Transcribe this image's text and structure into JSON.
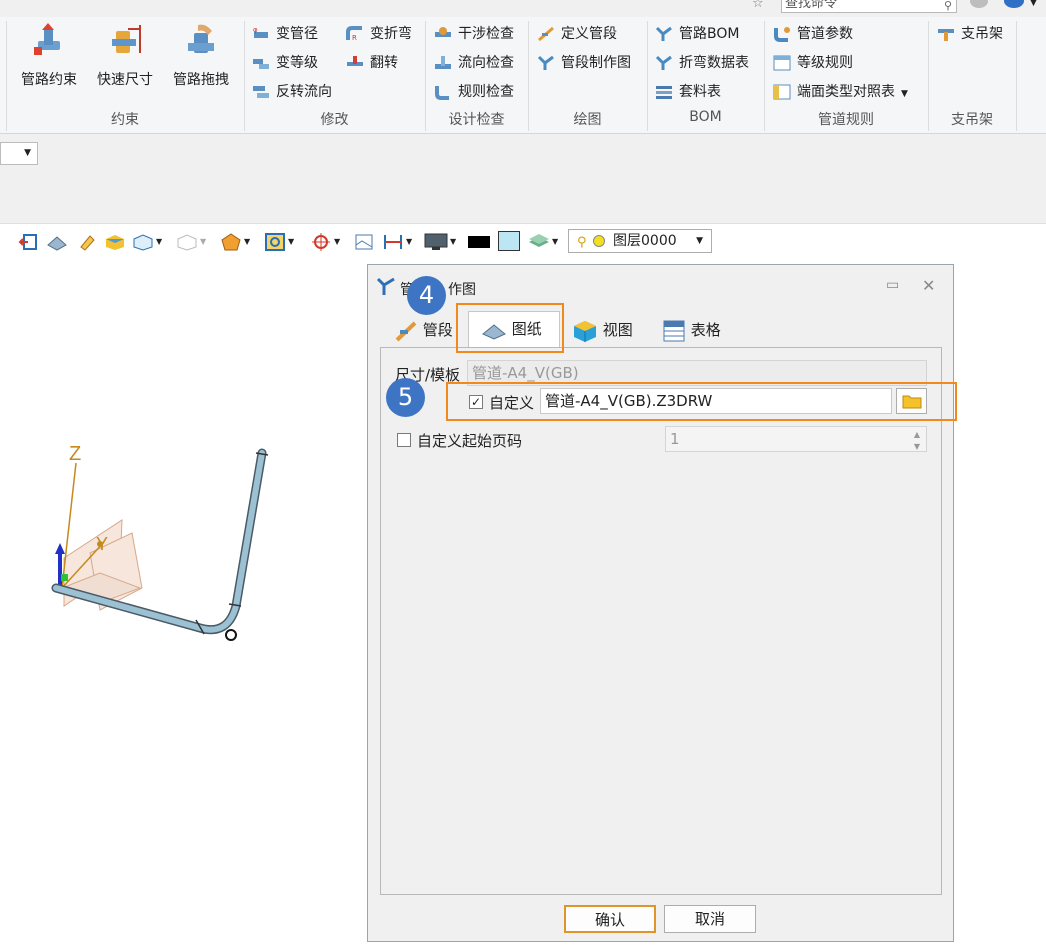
{
  "search": {
    "placeholder": "查找命令"
  },
  "ribbon": {
    "groups": [
      {
        "label": "约束"
      },
      {
        "label": "修改"
      },
      {
        "label": "设计检查"
      },
      {
        "label": "绘图"
      },
      {
        "label": "BOM"
      },
      {
        "label": "管道规则"
      },
      {
        "label": "支吊架"
      }
    ],
    "big_buttons": [
      "管路约束",
      "快速尺寸",
      "管路拖拽"
    ],
    "modify": [
      "变管径",
      "变折弯",
      "变等级",
      "翻转",
      "反转流向"
    ],
    "check": [
      "干涉检查",
      "流向检查",
      "规则检查"
    ],
    "drawing": [
      "定义管段",
      "管段制作图"
    ],
    "bom": [
      "管路BOM",
      "折弯数据表",
      "套料表"
    ],
    "rules": [
      "管道参数",
      "等级规则",
      "端面类型对照表"
    ],
    "support": [
      "支吊架"
    ]
  },
  "toolbar": {
    "layer_label": "图层0000"
  },
  "axes": {
    "z": "Z",
    "y": "Y"
  },
  "dialog": {
    "title_prefix": "管",
    "title_suffix": "作图",
    "tabs": [
      "管段",
      "图纸",
      "视图",
      "表格"
    ],
    "size_template_label": "尺寸/模板",
    "size_template_value": "管道-A4_V(GB)",
    "custom_label": "自定义",
    "custom_checked": true,
    "custom_value": "管道-A4_V(GB).Z3DRW",
    "start_page_label": "自定义起始页码",
    "start_page_checked": false,
    "start_page_value": "1",
    "ok_label": "确认",
    "cancel_label": "取消"
  },
  "badges": {
    "step4": "4",
    "step5": "5"
  },
  "colors": {
    "highlight": "#f08a1f",
    "badge": "#3d75c4",
    "pipe": "#8fb4c8"
  }
}
